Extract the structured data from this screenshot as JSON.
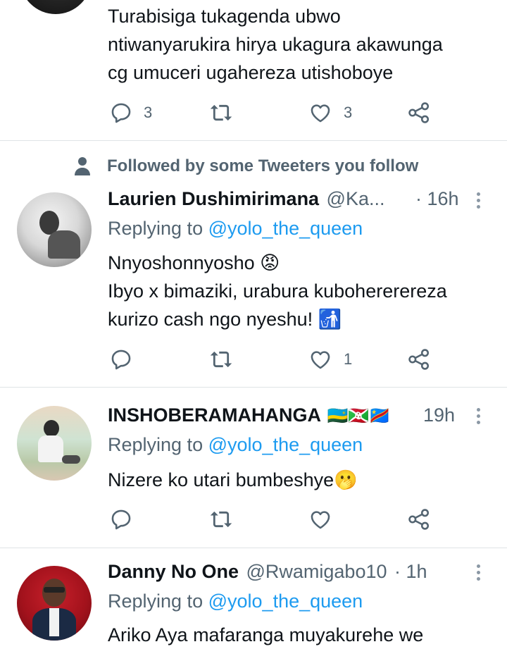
{
  "tweet0": {
    "text_lines": [
      "Turabisiga tukagenda ubwo",
      "ntiwanyarukira hirya ukagura akawunga",
      "cg umuceri ugahereza utishoboye"
    ],
    "replies": "3",
    "likes": "3"
  },
  "social_context": "Followed by some Tweeters you follow",
  "tweet1": {
    "name": "Laurien Dushimirimana",
    "handle": "@Ka...",
    "time": "· 16h",
    "replying_to": "Replying to",
    "mention": "@yolo_the_queen",
    "text_lines": [
      "Nnyoshonnyosho 😡",
      "Ibyo x bimaziki, urabura kubohererereza",
      "kurizo cash ngo nyeshu! 🚮"
    ],
    "likes": "1"
  },
  "tweet2": {
    "name": "INSHOBERAMAHANGA",
    "flags": "🇷🇼🇧🇮🇨🇩",
    "time": "19h",
    "replying_to": "Replying to",
    "mention": "@yolo_the_queen",
    "text_lines": [
      "Nizere ko utari bumbeshye🫢"
    ]
  },
  "tweet3": {
    "name": "Danny No One",
    "handle": "@Rwamigabo10",
    "time": "· 1h",
    "replying_to": "Replying to",
    "mention": "@yolo_the_queen",
    "text_lines": [
      "Ariko Aya mafaranga muyakurehe we"
    ]
  },
  "icons": {
    "reply": "reply-icon",
    "retweet": "retweet-icon",
    "like": "heart-icon",
    "share": "share-icon",
    "more": "more-icon",
    "person": "person-icon"
  },
  "colors": {
    "link": "#1d9bf0",
    "secondary": "#536471",
    "divider": "#dfe3e6"
  }
}
